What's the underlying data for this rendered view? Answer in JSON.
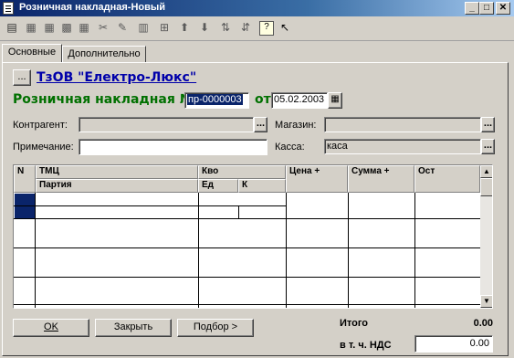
{
  "window": {
    "title": "Розничная накладная-Новый",
    "minimize": "_",
    "maximize": "□",
    "close": "✕"
  },
  "tabs": [
    {
      "label": "Основные",
      "active": true
    },
    {
      "label": "Дополнительно",
      "active": false
    }
  ],
  "header": {
    "firm_button": "...",
    "firm_name": "ТзОВ \"Електро-Люкс\"",
    "doc_label": "Розничная накладная №",
    "doc_number": "пр-0000003",
    "date_prefix": "от",
    "date": "05.02.2003"
  },
  "fields": {
    "counterparty_label": "Контрагент:",
    "counterparty_value": "",
    "store_label": "Магазин:",
    "store_value": "",
    "note_label": "Примечание:",
    "note_value": "",
    "cash_label": "Касса:",
    "cash_value": "каса",
    "dots": "..."
  },
  "table": {
    "col_n": "N",
    "col_tmc": "ТМЦ",
    "col_party": "Партия",
    "col_qty": "Кво",
    "col_unit": "Ед",
    "col_k": "К",
    "col_price": "Цена +",
    "col_sum": "Сумма +",
    "col_rest": "Ост"
  },
  "footer": {
    "ok": "OK",
    "close": "Закрыть",
    "select": "Подбор >",
    "total_label": "Итого",
    "total_value": "0.00",
    "vat_label": "в т. ч. НДС",
    "vat_value": "0.00"
  },
  "colors": {
    "title_start": "#0a246a",
    "title_end": "#a6caf0",
    "firm_link": "#0000aa",
    "doc_label": "#007000",
    "selected_cell": "#0a246a"
  }
}
